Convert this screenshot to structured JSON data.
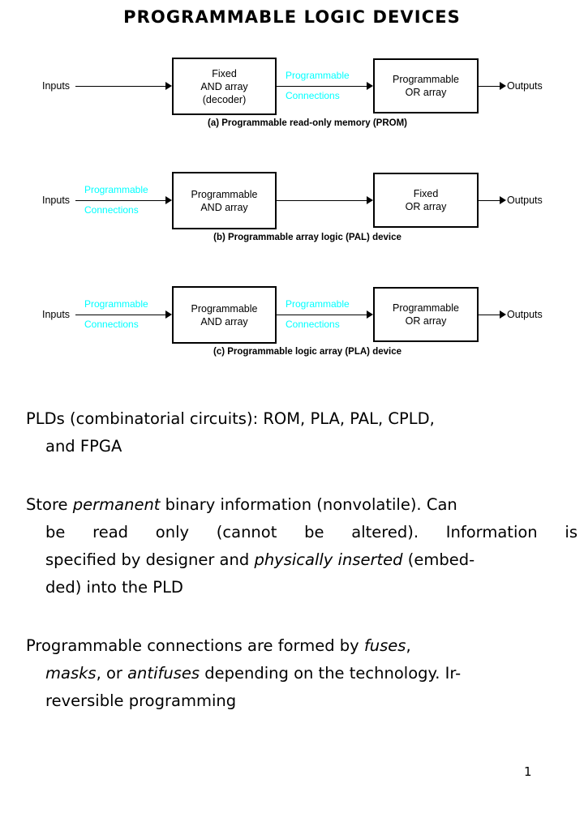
{
  "title": "PROGRAMMABLE LOGIC DEVICES",
  "colors": {
    "connection_label": "#00ffff",
    "text": "#000000",
    "background": "#ffffff"
  },
  "figure": {
    "input_label": "Inputs",
    "output_label": "Outputs",
    "connection_label_top": "Programmable",
    "connection_label_bottom": "Connections",
    "diagrams": [
      {
        "id": "a",
        "caption": "(a) Programmable read-only memory (PROM)",
        "left_block": {
          "line1": "Fixed",
          "line2": "AND array",
          "line3": "(decoder)"
        },
        "right_block": {
          "line1": "Programmable",
          "line2": "OR array"
        },
        "input_connection_programmable": false,
        "middle_connection_programmable": true
      },
      {
        "id": "b",
        "caption": "(b) Programmable array logic (PAL) device",
        "left_block": {
          "line1": "Programmable",
          "line2": "AND array"
        },
        "right_block": {
          "line1": "Fixed",
          "line2": "OR array"
        },
        "input_connection_programmable": true,
        "middle_connection_programmable": false
      },
      {
        "id": "c",
        "caption": "(c) Programmable logic array (PLA) device",
        "left_block": {
          "line1": "Programmable",
          "line2": "AND array"
        },
        "right_block": {
          "line1": "Programmable",
          "line2": "OR array"
        },
        "input_connection_programmable": true,
        "middle_connection_programmable": true
      }
    ]
  },
  "paragraphs": {
    "p1": {
      "line1": "PLDs (combinatorial circuits):  ROM, PLA, PAL, CPLD,",
      "line2": "and FPGA"
    },
    "p2": {
      "line1_a": "Store ",
      "line1_italic": "permanent",
      "line1_b": " binary information (nonvolatile). Can",
      "line2_w1": "be",
      "line2_w2": "read",
      "line2_w3": "only",
      "line2_w4": "(cannot",
      "line2_w5": "be",
      "line2_w6": "altered).",
      "line2_w7": "Information",
      "line2_w8": "is",
      "line3_a": "specified by designer and ",
      "line3_italic": "physically inserted",
      "line3_b": " (embed-",
      "line4": "ded) into the PLD"
    },
    "p3": {
      "line1_a": "Programmable connections are formed by ",
      "line1_italic": "fuses",
      "line1_b": ",",
      "line2_italic1": "masks",
      "line2_a": ", or ",
      "line2_italic2": "antifuses",
      "line2_b": " depending on the technology. Ir-",
      "line3": "reversible programming"
    }
  },
  "page_number": "1"
}
